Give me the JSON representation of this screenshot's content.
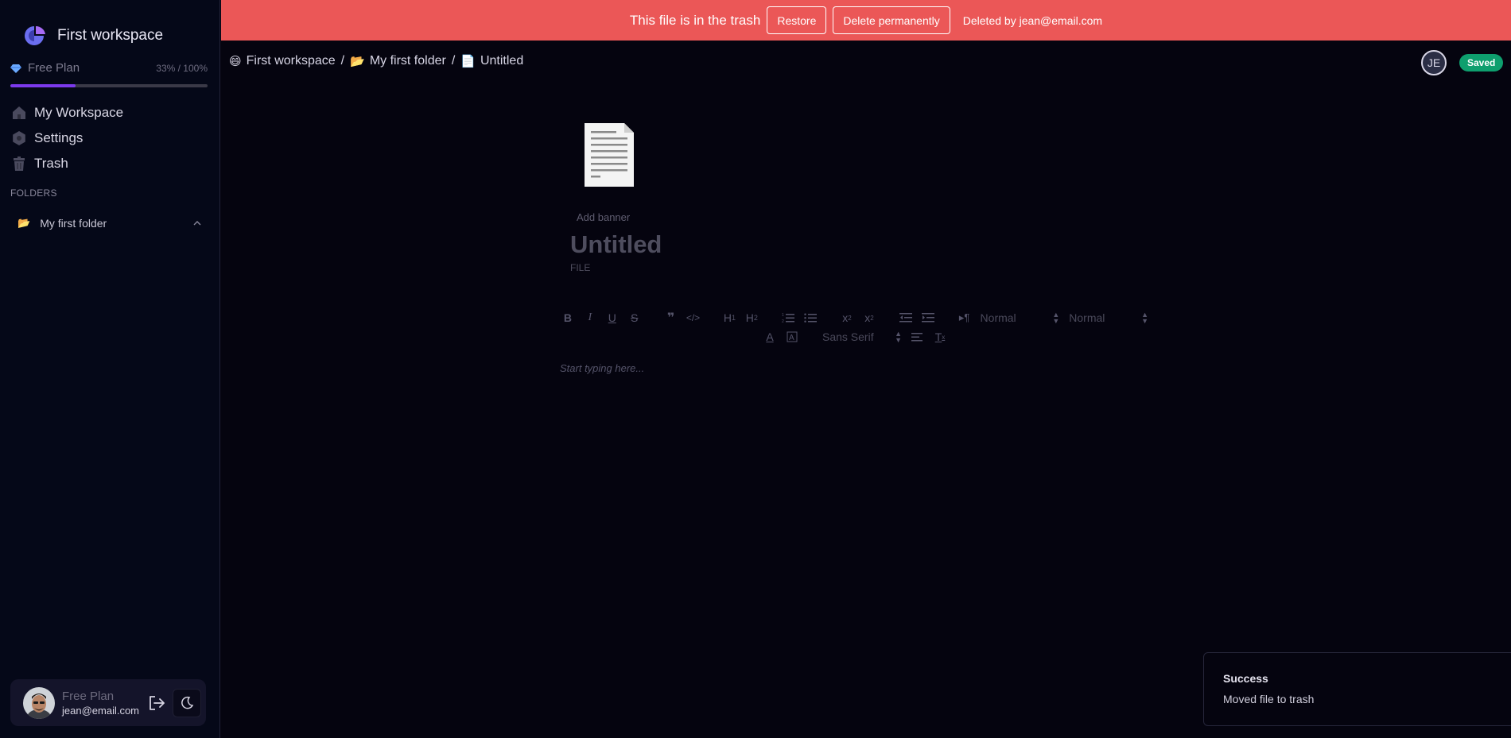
{
  "sidebar": {
    "workspace_name": "First workspace",
    "plan_label": "Free Plan",
    "plan_usage": "33% / 100%",
    "plan_progress_percent": 33,
    "nav": [
      {
        "label": "My Workspace",
        "icon": "home-icon"
      },
      {
        "label": "Settings",
        "icon": "settings-icon"
      },
      {
        "label": "Trash",
        "icon": "trash-icon"
      }
    ],
    "folders_title": "FOLDERS",
    "folders": [
      {
        "emoji": "📂",
        "label": "My first folder"
      }
    ],
    "user": {
      "plan": "Free Plan",
      "email": "jean@email.com"
    }
  },
  "banner": {
    "text": "This file is in the trash",
    "restore_label": "Restore",
    "delete_label": "Delete permanently",
    "deleted_by": "Deleted by jean@email.com",
    "color": "#eb5757"
  },
  "breadcrumb": [
    {
      "emoji": "😄",
      "label": "First workspace"
    },
    {
      "emoji": "📂",
      "label": "My first folder"
    },
    {
      "emoji": "📄",
      "label": "Untitled"
    }
  ],
  "topbar": {
    "collaborator_initials": "JE",
    "saved_label": "Saved",
    "saved_color": "#0e9f6e"
  },
  "document": {
    "icon_emoji": "📄",
    "add_banner_label": "Add banner",
    "title": "Untitled",
    "type_label": "FILE",
    "editor_placeholder": "Start typing here..."
  },
  "toolbar": {
    "header_select": "Normal",
    "size_select": "Normal",
    "font_select": "Sans Serif"
  },
  "toast": {
    "title": "Success",
    "message": "Moved file to trash"
  },
  "colors": {
    "accent": "#7c3aed",
    "background": "#05040f",
    "sidebar": "#050818"
  }
}
